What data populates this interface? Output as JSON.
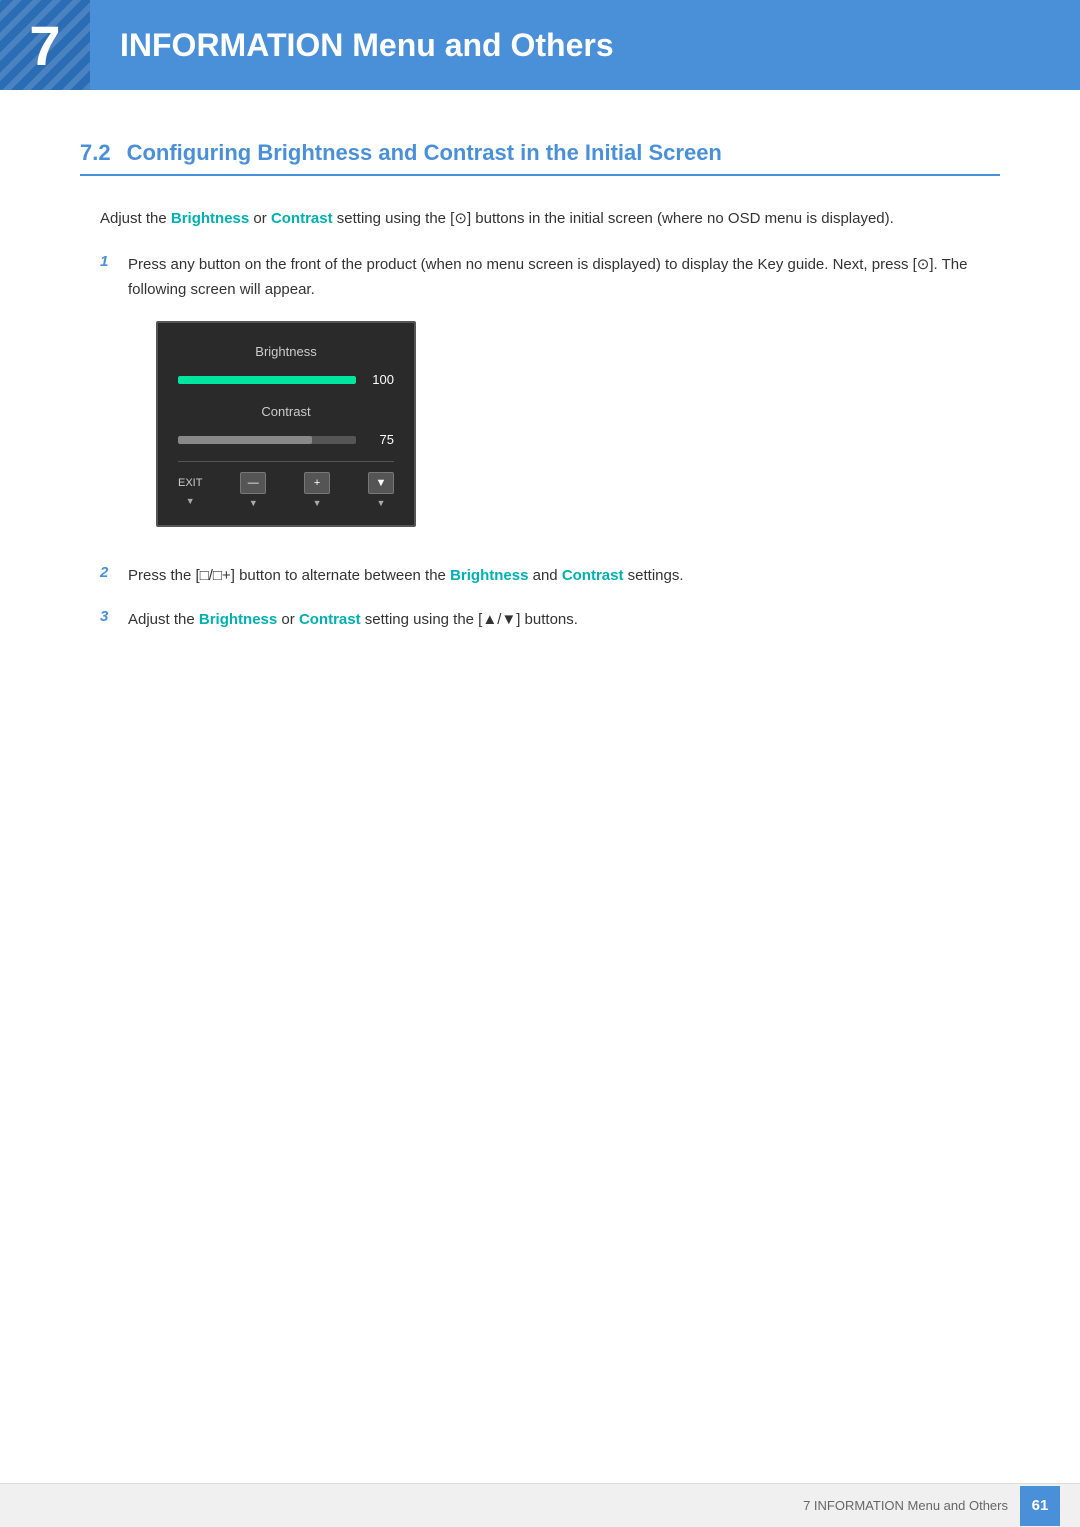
{
  "header": {
    "chapter_number": "7",
    "chapter_title": "INFORMATION Menu and Others"
  },
  "section": {
    "number": "7.2",
    "title": "Configuring Brightness and Contrast in the Initial Screen"
  },
  "intro_text": {
    "part1": "Adjust the ",
    "brightness_label": "Brightness",
    "part2": " or ",
    "contrast_label": "Contrast",
    "part3": " setting using the [",
    "button_symbol": "⊙",
    "part4": "] buttons in the initial screen (where no OSD menu is displayed)."
  },
  "steps": [
    {
      "number": "1",
      "text_part1": "Press any button on the front of the product (when no menu screen is displayed) to display the Key guide. Next, press [",
      "symbol": "⊙",
      "text_part2": "]. The following screen will appear."
    },
    {
      "number": "2",
      "text_part1": "Press the [□/□",
      "symbol2": "+",
      "text_part2": "] button to alternate between the ",
      "bold1": "Brightness",
      "text_part3": " and ",
      "bold2": "Contrast",
      "text_part4": " settings."
    },
    {
      "number": "3",
      "text_part1": "Adjust the ",
      "bold1": "Brightness",
      "text_part2": " or ",
      "bold2": "Contrast",
      "text_part3": " setting using the [▲/▼] buttons."
    }
  ],
  "osd": {
    "brightness_label": "Brightness",
    "brightness_value": "100",
    "contrast_label": "Contrast",
    "contrast_value": "75",
    "exit_label": "EXIT",
    "brightness_percent": 100,
    "contrast_percent": 75
  },
  "footer": {
    "text": "7 INFORMATION Menu and Others",
    "page_number": "61"
  }
}
